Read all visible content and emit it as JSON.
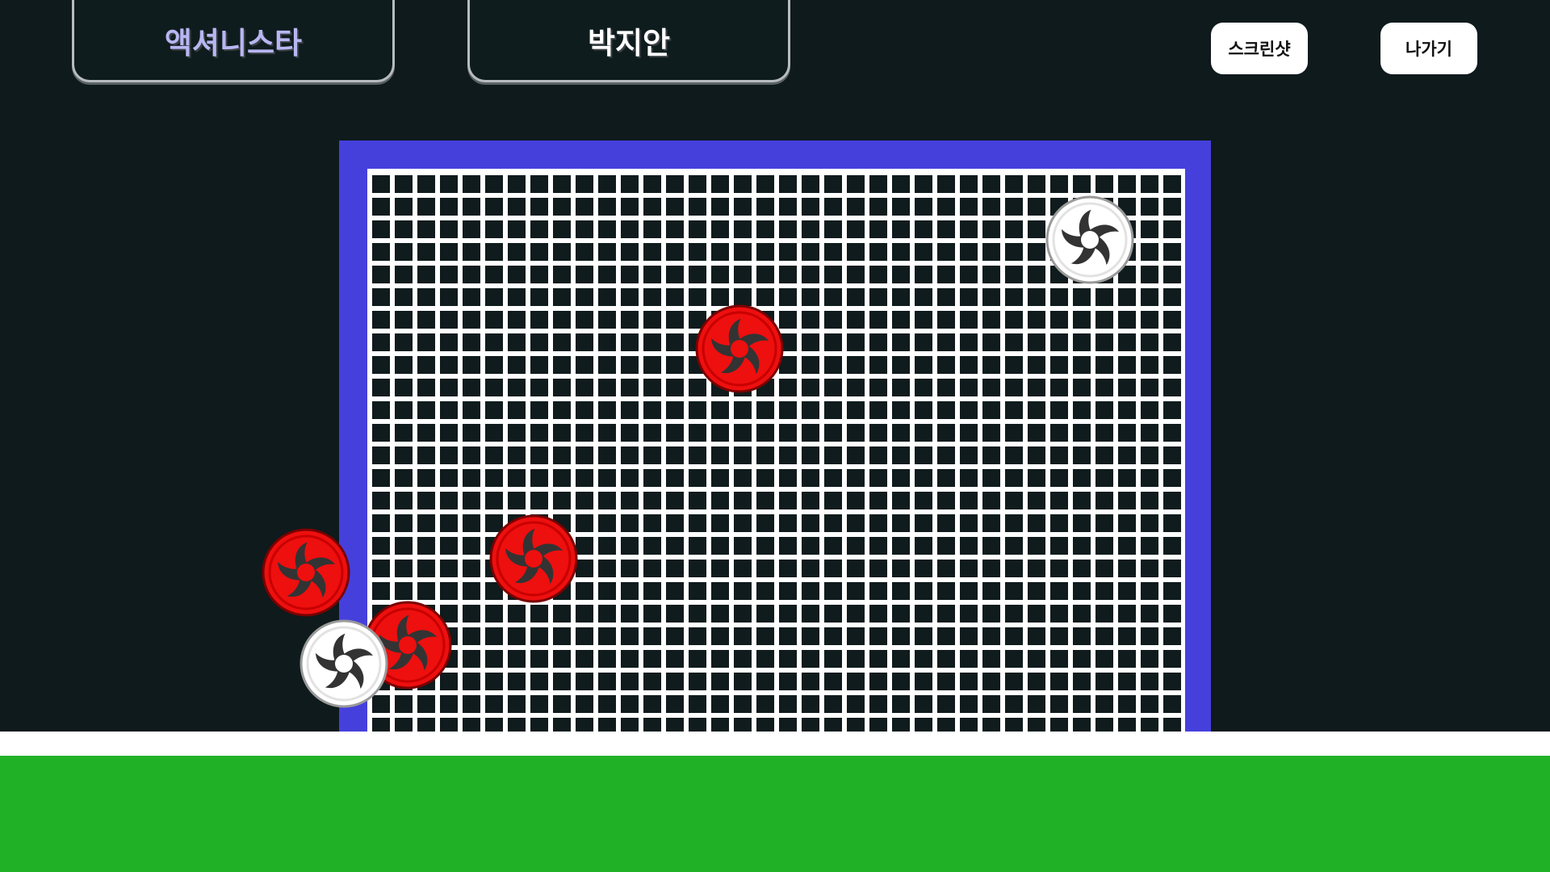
{
  "header": {
    "role_label": "액셔니스타",
    "player_name": "박지안",
    "screenshot_label": "스크린샷",
    "exit_label": "나가기"
  },
  "colors": {
    "background": "#0e1a1c",
    "goal_frame": "#4540dc",
    "net": "#ffffff",
    "ground_line": "#ffffff",
    "field": "#21b126",
    "role_text": "#b8b6f2",
    "ball_red": "#ee0f0f",
    "ball_white": "#ffffff"
  },
  "balls": [
    {
      "name": "white-ball-top-right",
      "color": "white"
    },
    {
      "name": "red-ball-center",
      "color": "red"
    },
    {
      "name": "red-ball-middle-left",
      "color": "red"
    },
    {
      "name": "red-ball-left-edge",
      "color": "red"
    },
    {
      "name": "red-ball-bottom-left",
      "color": "red"
    },
    {
      "name": "white-ball-bottom-left",
      "color": "white"
    }
  ]
}
